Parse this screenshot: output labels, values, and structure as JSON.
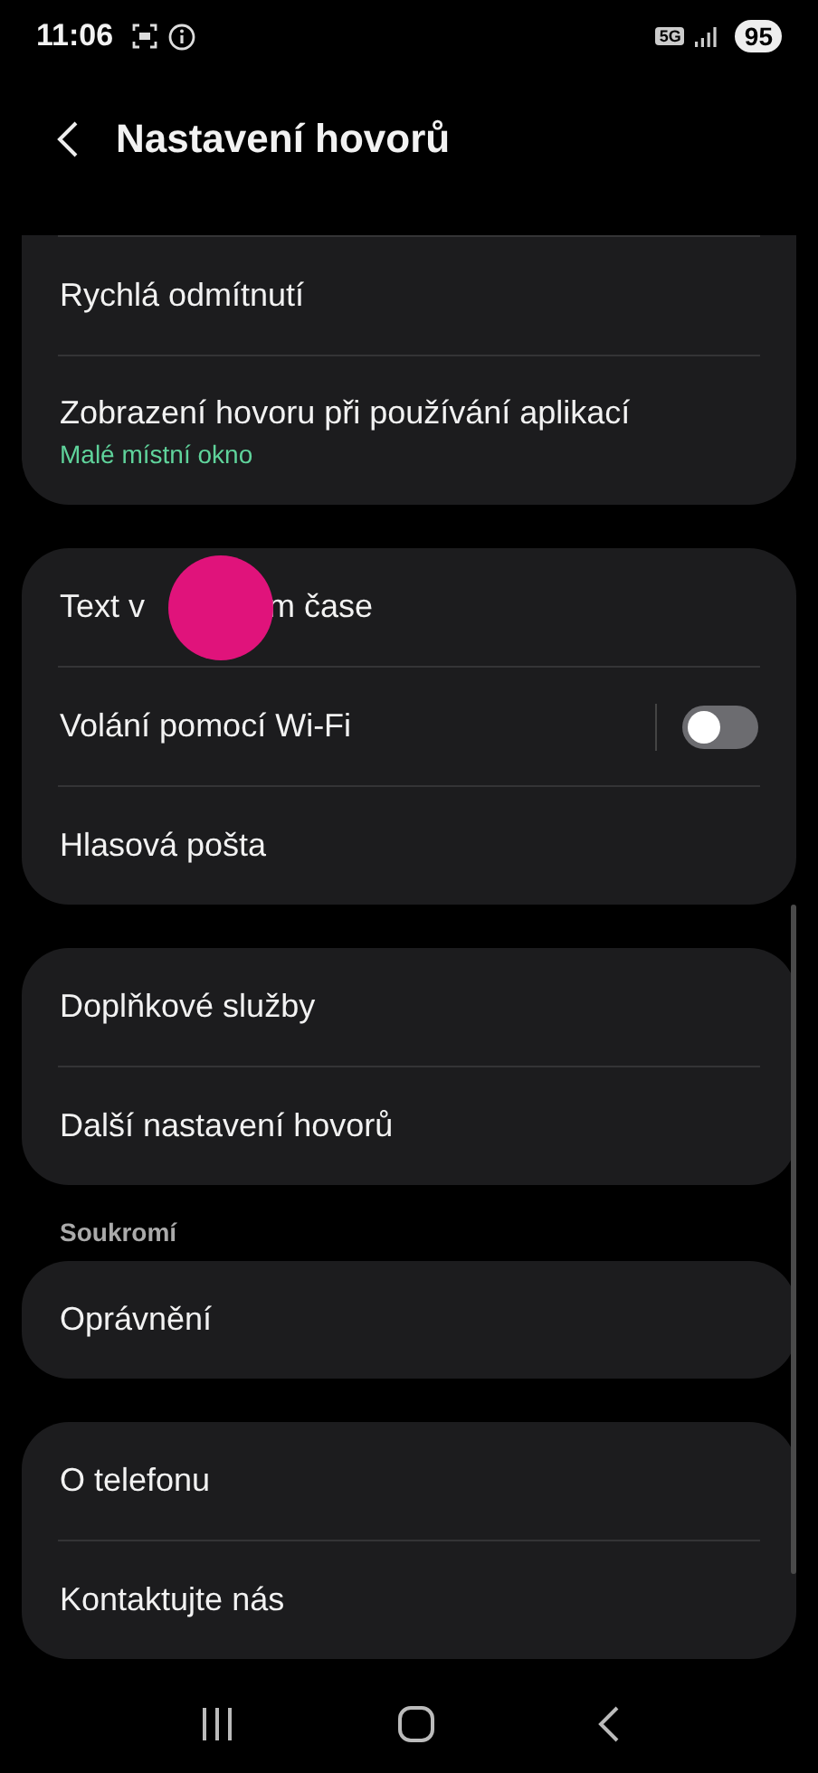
{
  "status_bar": {
    "time": "11:06",
    "network": "5G",
    "battery": "95"
  },
  "header": {
    "title": "Nastavení hovorů"
  },
  "groups": [
    {
      "cut_top": true,
      "items": [
        {
          "kind": "text",
          "title": "Rychlá odmítnutí"
        },
        {
          "kind": "text",
          "title": "Zobrazení hovoru při používání aplikací",
          "subtitle": "Malé místní okno"
        }
      ]
    },
    {
      "items": [
        {
          "kind": "covered",
          "parts": [
            "Text v",
            "m čase"
          ]
        },
        {
          "kind": "toggle",
          "title": "Volání pomocí Wi-Fi",
          "on": false
        },
        {
          "kind": "text",
          "title": "Hlasová pošta"
        }
      ]
    },
    {
      "items": [
        {
          "kind": "text",
          "title": "Doplňkové služby"
        },
        {
          "kind": "text",
          "title": "Další nastavení hovorů"
        }
      ]
    },
    {
      "label": "Soukromí",
      "items": [
        {
          "kind": "text",
          "title": "Oprávnění"
        }
      ]
    },
    {
      "items": [
        {
          "kind": "text",
          "title": "O telefonu"
        },
        {
          "kind": "text",
          "title": "Kontaktujte nás"
        }
      ]
    }
  ]
}
